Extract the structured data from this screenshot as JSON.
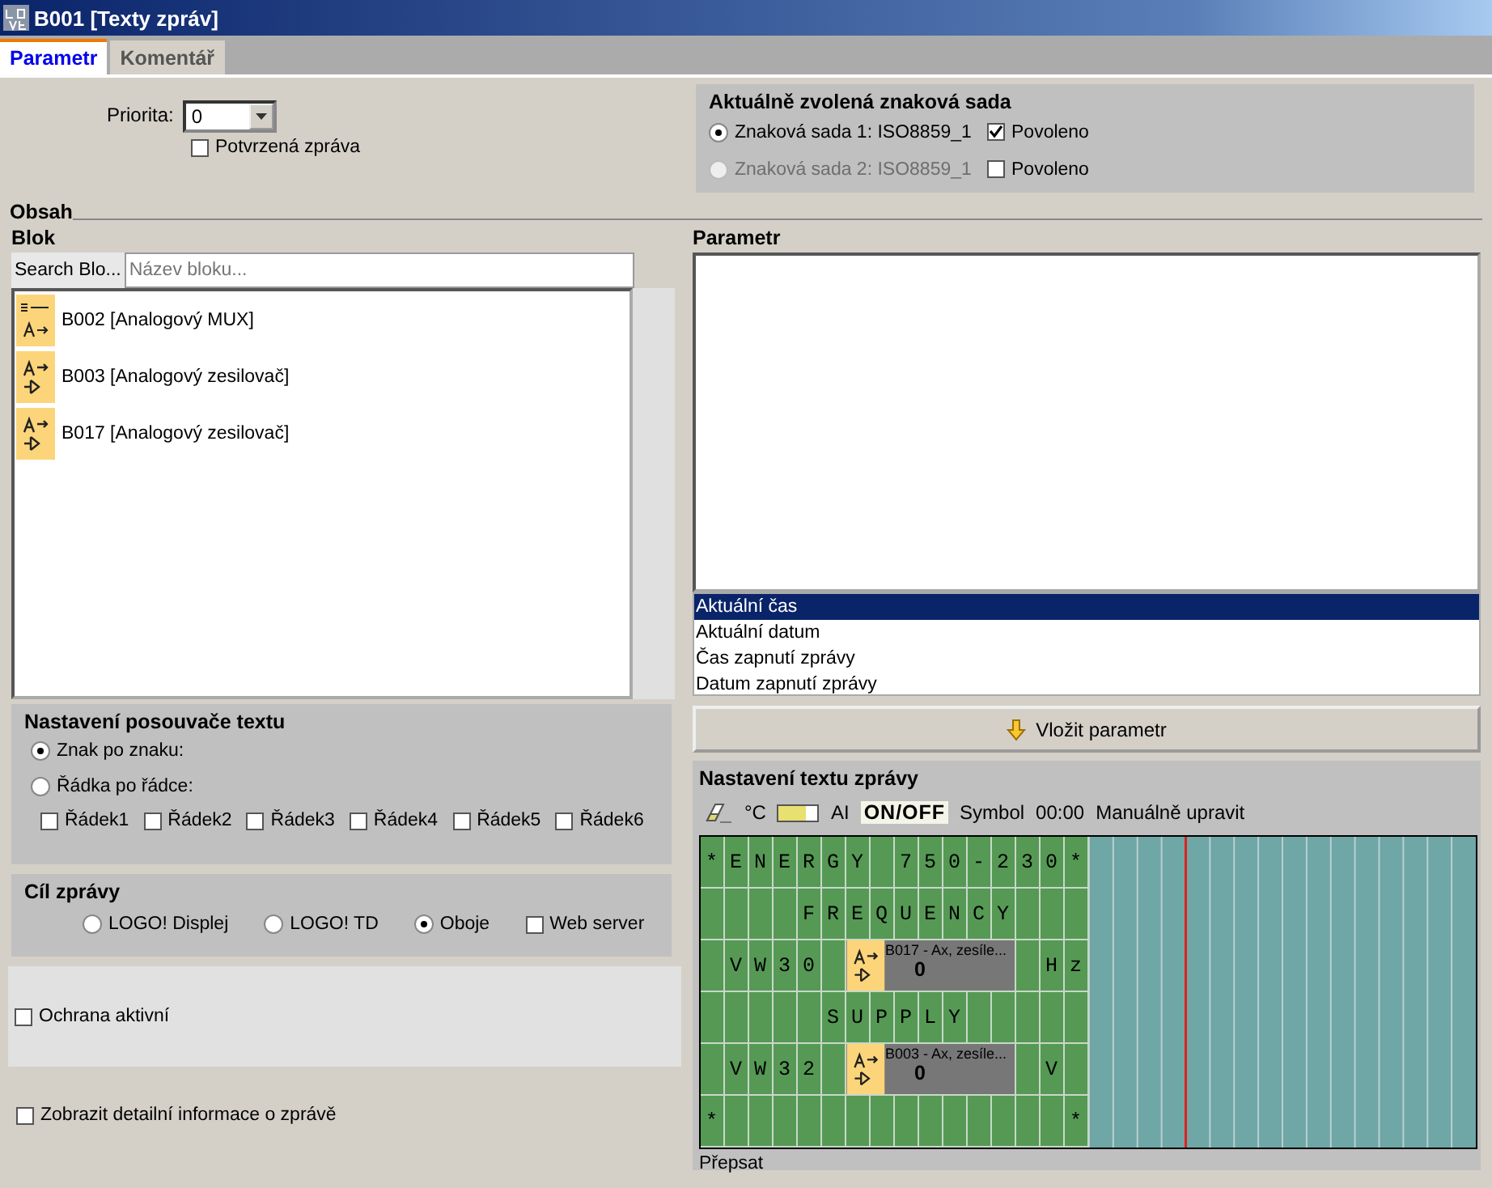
{
  "window": {
    "title": "B001 [Texty zpráv]"
  },
  "tabs": [
    {
      "label": "Parametr",
      "selected": true
    },
    {
      "label": "Komentář",
      "selected": false
    }
  ],
  "priority": {
    "label": "Priorita:",
    "value": "0"
  },
  "confirmed": {
    "label": "Potvrzená zpráva",
    "checked": false
  },
  "charset": {
    "title": "Aktuálně zvolená znaková sada",
    "sets": [
      {
        "label": "Znaková sada 1: ISO8859_1",
        "selected": true,
        "disabled": false,
        "enabled_label": "Povoleno",
        "enabled": true
      },
      {
        "label": "Znaková sada 2: ISO8859_1",
        "selected": false,
        "disabled": true,
        "enabled_label": "Povoleno",
        "enabled": false
      }
    ]
  },
  "content_heading": "Obsah",
  "block_panel": {
    "title": "Blok",
    "search_label": "Search Blo...",
    "search_placeholder": "Název bloku...",
    "items": [
      {
        "label": "B002 [Analogový MUX]",
        "kind": "mux"
      },
      {
        "label": "B003 [Analogový zesilovač]",
        "kind": "amplifier"
      },
      {
        "label": "B017 [Analogový zesilovač]",
        "kind": "amplifier"
      }
    ]
  },
  "ticker": {
    "title": "Nastavení posouvače textu",
    "modes": [
      {
        "label": "Znak po znaku:",
        "selected": true
      },
      {
        "label": "Řádka po řádce:",
        "selected": false
      }
    ],
    "lines": [
      {
        "label": "Řádek1",
        "checked": false
      },
      {
        "label": "Řádek2",
        "checked": false
      },
      {
        "label": "Řádek3",
        "checked": false
      },
      {
        "label": "Řádek4",
        "checked": false
      },
      {
        "label": "Řádek5",
        "checked": false
      },
      {
        "label": "Řádek6",
        "checked": false
      }
    ]
  },
  "destination": {
    "title": "Cíl zprávy",
    "options": [
      {
        "label": "LOGO! Displej",
        "kind": "radio",
        "selected": false
      },
      {
        "label": "LOGO! TD",
        "kind": "radio",
        "selected": false
      },
      {
        "label": "Oboje",
        "kind": "radio",
        "selected": true
      },
      {
        "label": "Web server",
        "kind": "checkbox",
        "checked": false
      }
    ]
  },
  "protection": {
    "label": "Ochrana aktivní",
    "checked": false
  },
  "details": {
    "label": "Zobrazit detailní informace o zprávě",
    "checked": false
  },
  "parameter_panel": {
    "title": "Parametr",
    "items": [
      {
        "label": "Aktuální čas",
        "selected": true
      },
      {
        "label": "Aktuální datum",
        "selected": false
      },
      {
        "label": "Čas zapnutí zprávy",
        "selected": false
      },
      {
        "label": "Datum zapnutí zprávy",
        "selected": false
      }
    ]
  },
  "insert_button": "Vložit parametr",
  "message_text": {
    "title": "Nastavení textu zprávy",
    "toolbar": [
      {
        "kind": "eraser"
      },
      {
        "kind": "text",
        "label": "°C"
      },
      {
        "kind": "bar"
      },
      {
        "kind": "text",
        "label": "AI"
      },
      {
        "kind": "onoff",
        "label": "ON/OFF"
      },
      {
        "kind": "text",
        "label": "Symbol"
      },
      {
        "kind": "text",
        "label": "00:00"
      },
      {
        "kind": "text",
        "label": "Manuálně upravit"
      }
    ],
    "rows": [
      [
        {
          "kind": "text",
          "text": "*ENERGY 750-230*"
        }
      ],
      [
        {
          "kind": "text",
          "text": "    FREQUENCY   "
        }
      ],
      [
        {
          "kind": "text",
          "text": " VW30 "
        },
        {
          "kind": "block",
          "title": "B017 - Ax, zesíle...",
          "value": "0"
        },
        {
          "kind": "text",
          "text": " Hz"
        }
      ],
      [
        {
          "kind": "text",
          "text": "     SUPPLY     "
        }
      ],
      [
        {
          "kind": "text",
          "text": " VW32 "
        },
        {
          "kind": "block",
          "title": "B003 - Ax, zesíle...",
          "value": "0"
        },
        {
          "kind": "text",
          "text": " V "
        }
      ],
      [
        {
          "kind": "text",
          "text": "* "
        },
        {
          "kind": "text",
          "text": "             *"
        }
      ]
    ],
    "mode": "Přepsat"
  }
}
